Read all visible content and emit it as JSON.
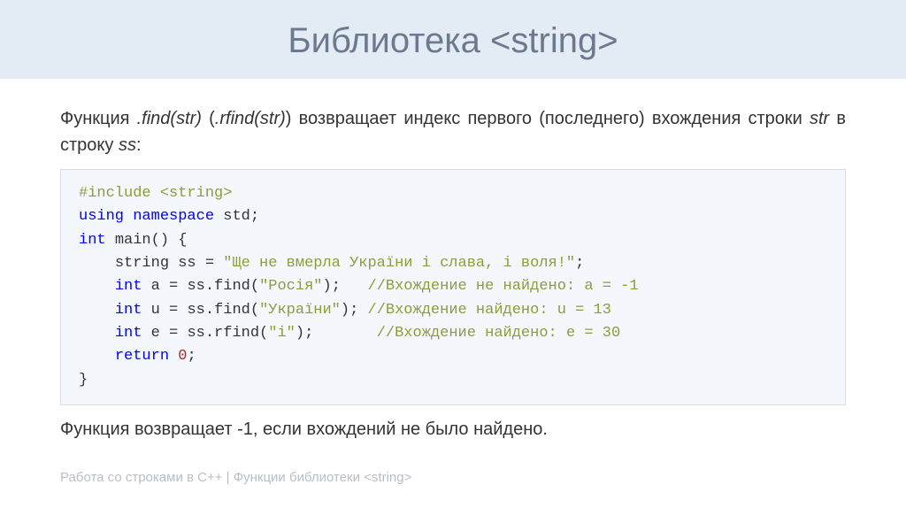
{
  "header": {
    "title": "Библиотека <string>"
  },
  "description": {
    "prefix": "Функция ",
    "fn1": ".find(str)",
    "paren_open": " (",
    "fn2": ".rfind(str)",
    "paren_close": ") ",
    "mid": "возвращает индекс первого (последнего) вхождения строки ",
    "str_var": "str",
    "mid2": " в строку ",
    "ss_var": "ss",
    "end": ":"
  },
  "code": {
    "include": "#include ",
    "string_lib": "<string>",
    "using": "using",
    "namespace": "namespace",
    "std": "std",
    "int_kw": "int",
    "main": "main",
    "string_type": "string",
    "ss_var": "ss",
    "ss_literal": "\"Ще не вмерла України і слава, і воля!\"",
    "a_var": "a",
    "find_call_a": "ss.find(",
    "lit_a": "\"Росія\"",
    "comment_a": "//Вхождение не найдено: a = -1",
    "u_var": "u",
    "find_call_u": "ss.find(",
    "lit_u": "\"України\"",
    "comment_u": "//Вхождение найдено: u = 13",
    "e_var": "e",
    "rfind_call_e": "ss.rfind(",
    "lit_e": "\"і\"",
    "comment_e": "//Вхождение найдено: e = 30",
    "return_kw": "return",
    "zero": "0",
    "semi": ";",
    "open_brace": " {",
    "close_brace": "}",
    "open_paren": "(",
    "close_paren": ")",
    "eq": " = "
  },
  "post_note": "Функция возвращает -1, если вхождений не было найдено.",
  "footer": "Работа со строками в C++ | Функции библиотеки <string>"
}
